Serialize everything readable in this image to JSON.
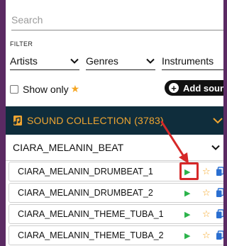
{
  "search": {
    "placeholder": "Search",
    "value": ""
  },
  "filter": {
    "label": "FILTER",
    "dropdowns": [
      {
        "selected": "Artists"
      },
      {
        "selected": "Genres"
      },
      {
        "selected": "Instruments"
      }
    ]
  },
  "show_only": {
    "label": "Show only",
    "icon": "star-icon"
  },
  "add_sound": {
    "label": "Add sound",
    "icon": "plus-circle-icon"
  },
  "collection": {
    "title": "SOUND COLLECTION (3783)",
    "icon": "music-file-icon",
    "accent_color": "#f0a531",
    "header_bg": "#0f2d3c"
  },
  "group": {
    "label": "CIARA_MELANIN_BEAT",
    "expanded": true
  },
  "sounds": [
    {
      "label": "CIARA_MELANIN_DRUMBEAT_1"
    },
    {
      "label": "CIARA_MELANIN_DRUMBEAT_2"
    },
    {
      "label": "CIARA_MELANIN_THEME_TUBA_1"
    },
    {
      "label": "CIARA_MELANIN_THEME_TUBA_2"
    }
  ],
  "annotation": {
    "color": "#d62828",
    "target": "play-button on first sound row"
  }
}
